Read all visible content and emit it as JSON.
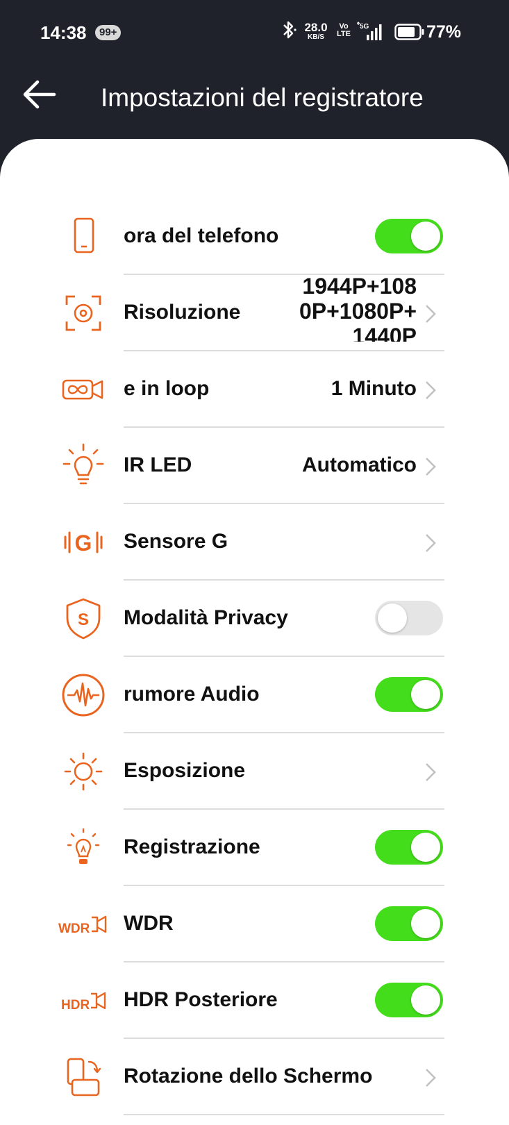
{
  "status_bar": {
    "time": "14:38",
    "notification_badge": "99+",
    "net_speed_value": "28.0",
    "net_speed_unit": "KB/S",
    "volte_top": "Vo",
    "volte_bottom": "LTE",
    "network": "5G",
    "battery": "77%",
    "icons": [
      "bluetooth-icon",
      "signal-icon",
      "battery-icon"
    ]
  },
  "header": {
    "title": "Impostazioni del registratore",
    "back_icon": "arrow-left-icon"
  },
  "colors": {
    "header_bg": "#1f222b",
    "accent": "#e9641f",
    "toggle_on": "#44dd1b",
    "toggle_off": "#e5e5e5"
  },
  "settings": [
    {
      "label": "ora del telefono",
      "icon": "phone-icon",
      "control": "toggle",
      "state": "on"
    },
    {
      "label": "Risoluzione",
      "icon": "camera-focus-icon",
      "control": "value",
      "value": "1944P+1080P+1080P+1440P"
    },
    {
      "label": "e in loop",
      "icon": "loop-video-icon",
      "control": "value",
      "value": "1 Minuto"
    },
    {
      "label": "IR LED",
      "icon": "bulb-icon",
      "control": "value",
      "value": "Automatico"
    },
    {
      "label": "Sensore G",
      "icon": "g-sensor-icon",
      "control": "chevron"
    },
    {
      "label": "Modalità Privacy",
      "icon": "shield-icon",
      "control": "toggle",
      "state": "off"
    },
    {
      "label": "rumore Audio",
      "icon": "audio-wave-icon",
      "control": "toggle",
      "state": "on"
    },
    {
      "label": "Esposizione",
      "icon": "sun-icon",
      "control": "chevron"
    },
    {
      "label": "Registrazione",
      "icon": "lightbulb-icon",
      "control": "toggle",
      "state": "on"
    },
    {
      "label": "WDR",
      "icon": "wdr-icon",
      "control": "toggle",
      "state": "on"
    },
    {
      "label": "HDR Posteriore",
      "icon": "hdr-icon",
      "control": "toggle",
      "state": "on"
    },
    {
      "label": "Rotazione dello Schermo",
      "icon": "screen-rotate-icon",
      "control": "chevron"
    }
  ]
}
